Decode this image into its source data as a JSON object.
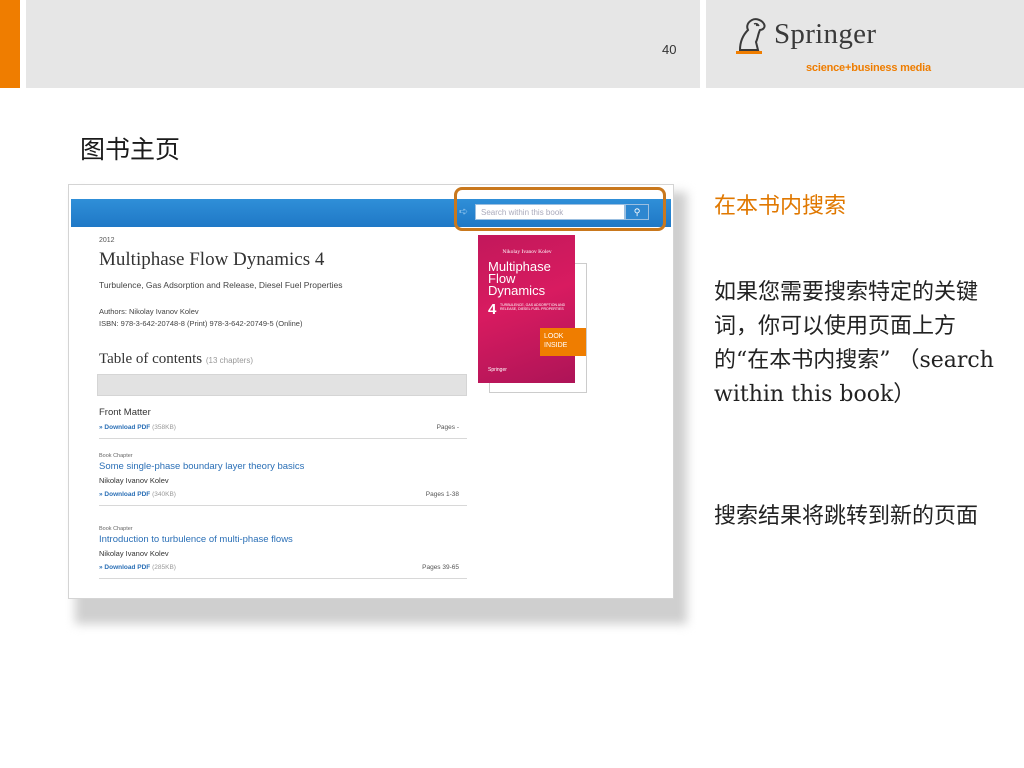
{
  "header": {
    "page_number": "40",
    "logo": {
      "wordmark": "Springer",
      "tagline": "science+business media"
    },
    "colors": {
      "accent": "#ef7d00",
      "band": "#e6e6e6"
    }
  },
  "slide_title": "图书主页",
  "screenshot": {
    "search_placeholder": "Search within this book",
    "search_button_icon": "search-icon",
    "year": "2012",
    "book_title": "Multiphase Flow Dynamics 4",
    "subtitle": "Turbulence, Gas Adsorption and Release, Diesel Fuel Properties",
    "authors": "Authors: Nikolay Ivanov Kolev",
    "isbn": "ISBN: 978-3-642-20748-8 (Print) 978-3-642-20749-5 (Online)",
    "toc_heading": "Table of contents",
    "toc_count": "(13 chapters)",
    "rows": [
      {
        "kind": "",
        "title": "Front Matter",
        "author": "",
        "download": "» Download PDF",
        "size": "(358KB)",
        "pages": "Pages -"
      },
      {
        "kind": "Book Chapter",
        "title": "Some single-phase boundary layer theory basics",
        "author": "Nikolay Ivanov Kolev",
        "download": "» Download PDF",
        "size": "(340KB)",
        "pages": "Pages 1-38"
      },
      {
        "kind": "Book Chapter",
        "title": "Introduction to turbulence of multi-phase flows",
        "author": "Nikolay Ivanov Kolev",
        "download": "» Download PDF",
        "size": "(285KB)",
        "pages": "Pages 39-65"
      }
    ],
    "cover": {
      "author": "Nikolay Ivanov Kolev",
      "title_line1": "Multiphase",
      "title_line2": "Flow",
      "title_line3": "Dynamics",
      "number": "4",
      "subtitle": "TURBULENCE, GAS ADSORPTION AND RELEASE, DIESEL FUEL PROPERTIES",
      "publisher": "Springer"
    },
    "look_inside_line1": "LOOK",
    "look_inside_line2": "INSIDE"
  },
  "right_panel": {
    "heading": "在本书内搜索",
    "para1": "如果您需要搜索特定的关键词，你可以使用页面上方的“在本书内搜索” （search within this book）",
    "para2": "搜索结果将跳转到新的页面"
  }
}
